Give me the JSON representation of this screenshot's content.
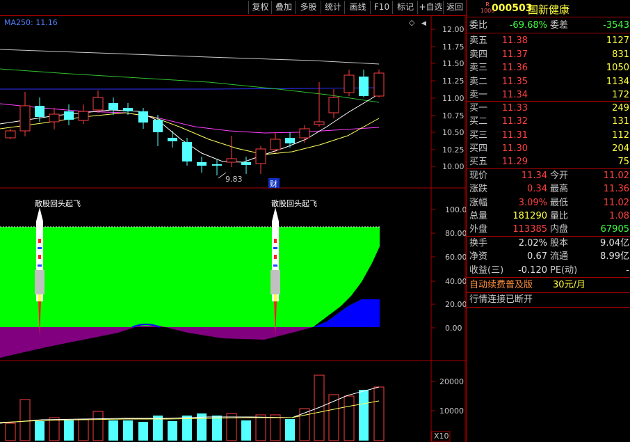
{
  "toolbar": {
    "buttons": [
      "复权",
      "叠加",
      "多股",
      "统计",
      "画线",
      "F10",
      "标记",
      "+自选",
      "返回"
    ]
  },
  "kline": {
    "ma_label": "MA250: 11.16",
    "y_ticks": [
      "12.00",
      "11.75",
      "11.50",
      "11.25",
      "11.00",
      "10.75",
      "10.50",
      "10.25",
      "10.00"
    ],
    "low_marker": "9.83",
    "finance_tag": "财",
    "corner_icon": "diamond-icon"
  },
  "indicator": {
    "signal_text": "散股回头起飞",
    "y_ticks": [
      "100.0",
      "80.00",
      "60.00",
      "40.00",
      "20.00",
      "0.00"
    ]
  },
  "volume": {
    "y_ticks": [
      "20000",
      "10000"
    ],
    "unit": "X10"
  },
  "quote": {
    "r_badge_top": "R",
    "r_badge_bottom": "1000",
    "code": "000503",
    "name": "国新健康",
    "weibi": {
      "label": "委比",
      "value": "-69.68%"
    },
    "weicha": {
      "label": "委差",
      "value": "-3543"
    },
    "asks": [
      {
        "label": "卖五",
        "price": "11.38",
        "vol": "1127"
      },
      {
        "label": "卖四",
        "price": "11.37",
        "vol": "831"
      },
      {
        "label": "卖三",
        "price": "11.36",
        "vol": "1050"
      },
      {
        "label": "卖二",
        "price": "11.35",
        "vol": "1134"
      },
      {
        "label": "卖一",
        "price": "11.34",
        "vol": "172"
      }
    ],
    "bids": [
      {
        "label": "买一",
        "price": "11.33",
        "vol": "249"
      },
      {
        "label": "买二",
        "price": "11.32",
        "vol": "131"
      },
      {
        "label": "买三",
        "price": "11.31",
        "vol": "112"
      },
      {
        "label": "买四",
        "price": "11.30",
        "vol": "204"
      },
      {
        "label": "买五",
        "price": "11.29",
        "vol": "75"
      }
    ],
    "stats": [
      {
        "l1": "现价",
        "v1": "11.34",
        "c1": "red",
        "l2": "今开",
        "v2": "11.02",
        "c2": "red"
      },
      {
        "l1": "涨跌",
        "v1": "0.34",
        "c1": "red",
        "l2": "最高",
        "v2": "11.36",
        "c2": "red"
      },
      {
        "l1": "涨幅",
        "v1": "3.09%",
        "c1": "red",
        "l2": "最低",
        "v2": "11.02",
        "c2": "red"
      },
      {
        "l1": "总量",
        "v1": "181290",
        "c1": "yellow",
        "l2": "量比",
        "v2": "1.08",
        "c2": "red"
      },
      {
        "l1": "外盘",
        "v1": "113385",
        "c1": "red",
        "l2": "内盘",
        "v2": "67905",
        "c2": "green"
      }
    ],
    "stats2": [
      {
        "l1": "换手",
        "v1": "2.02%",
        "l2": "股本",
        "v2": "9.04亿"
      },
      {
        "l1": "净资",
        "v1": "0.67",
        "l2": "流通",
        "v2": "8.99亿"
      },
      {
        "l1": "收益(三)",
        "v1": "-0.120",
        "l2": "PE(动)",
        "v2": "-"
      }
    ],
    "promo": {
      "text": "自动续费普及版",
      "price": "30元/月"
    },
    "conn_status": "行情连接已断开"
  },
  "colors": {
    "up": "#ff4040",
    "down": "#54ffff",
    "border": "#aa0000",
    "indicator_fill": "#00ff00",
    "indicator_blue": "#0000ff",
    "indicator_purple": "#800080"
  }
}
